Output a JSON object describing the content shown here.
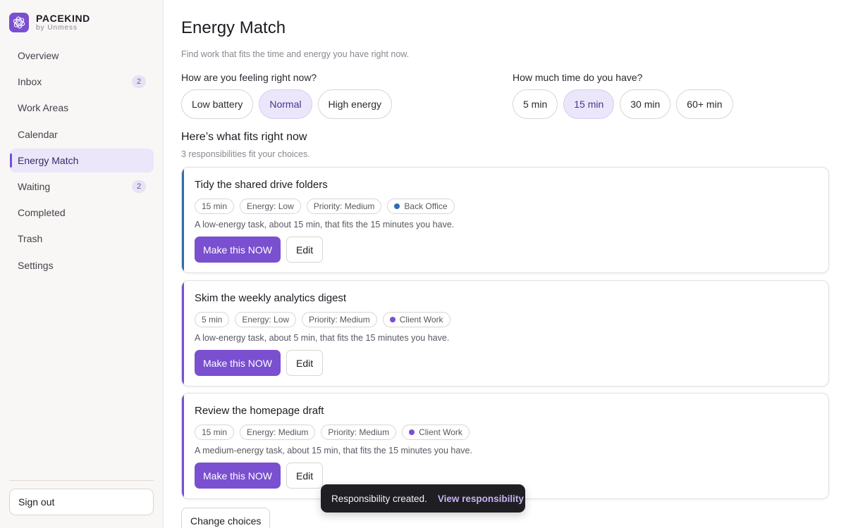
{
  "brand": {
    "name": "PACEKIND",
    "sub": "by Unmess"
  },
  "sidebar": {
    "items": [
      {
        "label": "Overview",
        "badge": ""
      },
      {
        "label": "Inbox",
        "badge": "2"
      },
      {
        "label": "Work Areas",
        "badge": ""
      },
      {
        "label": "Calendar",
        "badge": ""
      },
      {
        "label": "Energy Match",
        "badge": "",
        "active": true
      },
      {
        "label": "Waiting",
        "badge": "2"
      },
      {
        "label": "Completed",
        "badge": ""
      },
      {
        "label": "Trash",
        "badge": ""
      },
      {
        "label": "Settings",
        "badge": ""
      }
    ],
    "signout_label": "Sign out"
  },
  "main": {
    "title": "Energy Match",
    "subtitle": "Find work that fits the time and energy you have right now.",
    "feeling": {
      "label": "How are you feeling right now?",
      "options": [
        "Low battery",
        "Normal",
        "High energy"
      ],
      "selected": "Normal"
    },
    "time": {
      "label": "How much time do you have?",
      "options": [
        "5 min",
        "15 min",
        "30 min",
        "60+ min"
      ],
      "selected": "15 min"
    },
    "results_title": "Here’s what fits right now",
    "results_sub": "3 responsibilities fit your choices.",
    "cards": [
      {
        "title": "Tidy the shared drive folders",
        "duration": "15 min",
        "energy": "Energy: Low",
        "priority": "Priority: Medium",
        "area": "Back Office",
        "area_color": "#2f6db5",
        "description": "A low-energy task, about 15 min, that fits the 15 minutes you have.",
        "primary_label": "Make this NOW",
        "secondary_label": "Edit"
      },
      {
        "title": "Skim the weekly analytics digest",
        "duration": "5 min",
        "energy": "Energy: Low",
        "priority": "Priority: Medium",
        "area": "Client Work",
        "area_color": "#7a4fd0",
        "description": "A low-energy task, about 5 min, that fits the 15 minutes you have.",
        "primary_label": "Make this NOW",
        "secondary_label": "Edit"
      },
      {
        "title": "Review the homepage draft",
        "duration": "15 min",
        "energy": "Energy: Medium",
        "priority": "Priority: Medium",
        "area": "Client Work",
        "area_color": "#7a4fd0",
        "description": "A medium-energy task, about 15 min, that fits the 15 minutes you have.",
        "primary_label": "Make this NOW",
        "secondary_label": "Edit"
      }
    ],
    "change_choices_label": "Change choices"
  },
  "toast": {
    "message": "Responsibility created.",
    "link": "View responsibility"
  },
  "colors": {
    "accent": "#7a4fd0",
    "accent_soft": "#ece6fa"
  }
}
